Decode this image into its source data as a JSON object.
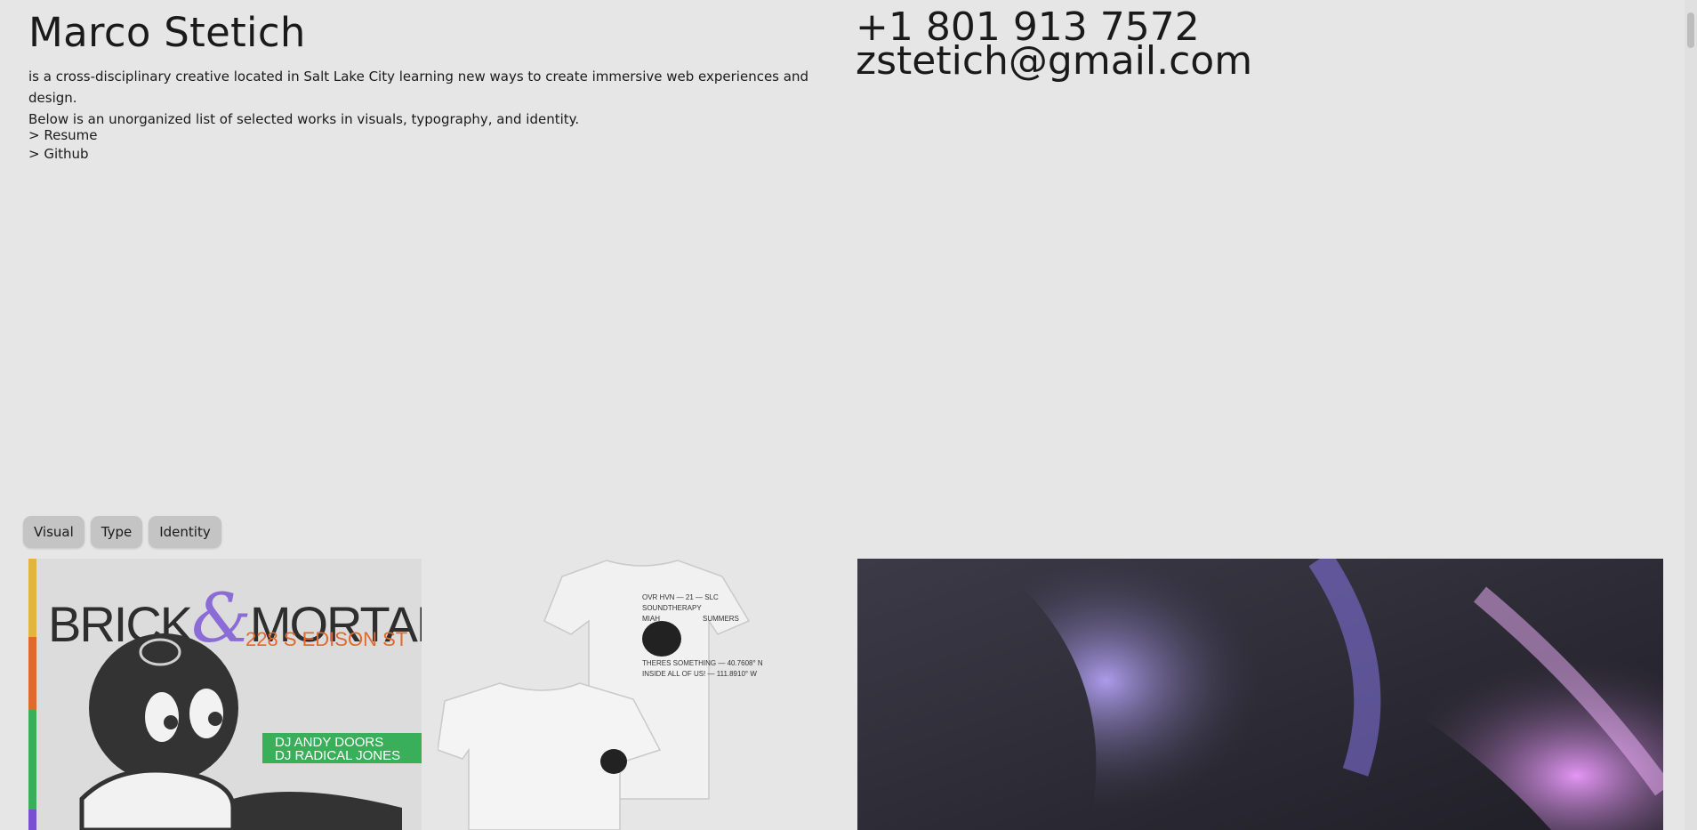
{
  "header": {
    "name": "Marco Stetich",
    "bio_line1": "is a cross-disciplinary creative located in Salt Lake City learning new ways to create immersive web experiences and design.",
    "bio_line2": "Below is an unorganized list of selected works in visuals, typography, and identity.",
    "links": [
      {
        "label": "> Resume"
      },
      {
        "label": "> Github"
      }
    ]
  },
  "contact": {
    "phone": "+1 801 913 7572",
    "email": "zstetich@gmail.com"
  },
  "filters": [
    "Visual",
    "Type",
    "Identity"
  ],
  "works": {
    "poster": {
      "title_left": "BRICK",
      "ampersand": "&",
      "title_right": "MORTAR",
      "address": "228 S EDISON ST",
      "dj1": "DJ ANDY DOORS",
      "dj2": "DJ RADICAL JONES"
    },
    "shirts": {
      "lines": [
        "OVR HVN — 21 — SLC",
        "SOUNDTHERAPY",
        "MIAH",
        "SUMMERS"
      ],
      "coords": [
        "THERES SOMETHING — 40.7608° N",
        "INSIDE ALL OF US! — 111.8910° W"
      ]
    }
  },
  "colors": {
    "background": "#e6e6e6",
    "filter_button": "#c4c4c4",
    "poster_orange": "#e06a2e",
    "poster_green": "#3aaf5a",
    "poster_purple": "#8b6cd6",
    "aurora_violet": "#9a86f0"
  }
}
